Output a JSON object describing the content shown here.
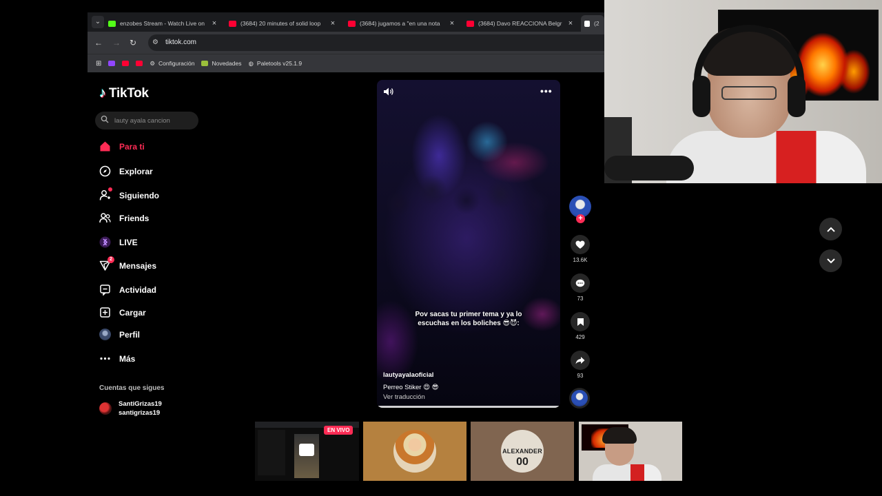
{
  "browser": {
    "tabs": [
      {
        "title": "enzobes Stream - Watch Live on",
        "favicon_color": "#53fc18",
        "active": false
      },
      {
        "title": "(3684) 20 minutes of solid loop",
        "favicon_color": "#ff0033",
        "active": false
      },
      {
        "title": "(3684) jugamos a \"en una nota",
        "favicon_color": "#ff0033",
        "active": false
      },
      {
        "title": "(3684) Davo REACCIONA Belgr",
        "favicon_color": "#ff0033",
        "active": false
      },
      {
        "title": "(2",
        "favicon_color": "#ffffff",
        "active": true
      }
    ],
    "url": "tiktok.com",
    "bookmarks": [
      {
        "label": "",
        "icon": "apps-grid-icon"
      },
      {
        "label": "",
        "icon": "twitch-icon",
        "color": "#9146ff"
      },
      {
        "label": "",
        "icon": "youtube-icon",
        "color": "#ff0033"
      },
      {
        "label": "",
        "icon": "youtube-icon",
        "color": "#ff0033"
      },
      {
        "label": "Configuración",
        "icon": "gear-icon"
      },
      {
        "label": "Novedades",
        "icon": "news-icon",
        "color": "#9bbf3b"
      },
      {
        "label": "Paletools v25.1.9",
        "icon": "globe-icon"
      }
    ]
  },
  "tiktok": {
    "logo_text": "TikTok",
    "search_placeholder": "lauty ayala cancion",
    "nav": [
      {
        "label": "Para ti",
        "icon": "home-icon",
        "active": true
      },
      {
        "label": "Explorar",
        "icon": "compass-icon"
      },
      {
        "label": "Siguiendo",
        "icon": "following-icon",
        "dot": true
      },
      {
        "label": "Friends",
        "icon": "friends-icon"
      },
      {
        "label": "LIVE",
        "icon": "live-icon"
      },
      {
        "label": "Mensajes",
        "icon": "messages-icon",
        "badge": "2"
      },
      {
        "label": "Actividad",
        "icon": "activity-icon"
      },
      {
        "label": "Cargar",
        "icon": "upload-icon"
      },
      {
        "label": "Perfil",
        "icon": "profile-avatar-icon"
      },
      {
        "label": "Más",
        "icon": "more-icon"
      }
    ],
    "following_title": "Cuentas que sigues",
    "following_user": {
      "display_name": "SantiGrizas19",
      "handle": "santigrizas19"
    }
  },
  "video": {
    "overlay_text": "Pov sacas tu primer tema y ya lo escuchas en los boliches 😎😈:",
    "author": "lautyayalaoficial",
    "caption": "Perreo Stiker 😍 😎",
    "translate_label": "Ver traducción",
    "progress_fraction": 1.0,
    "likes": "13.6K",
    "comments": "73",
    "saves": "429",
    "shares": "93"
  },
  "live_bar": {
    "live_badge": "EN VIVO",
    "card3_jersey_name": "ALEXANDER",
    "card3_jersey_number": "00"
  },
  "colors": {
    "accent": "#fe2c55",
    "page_bg": "#000000",
    "browser_bg": "#35363a"
  }
}
